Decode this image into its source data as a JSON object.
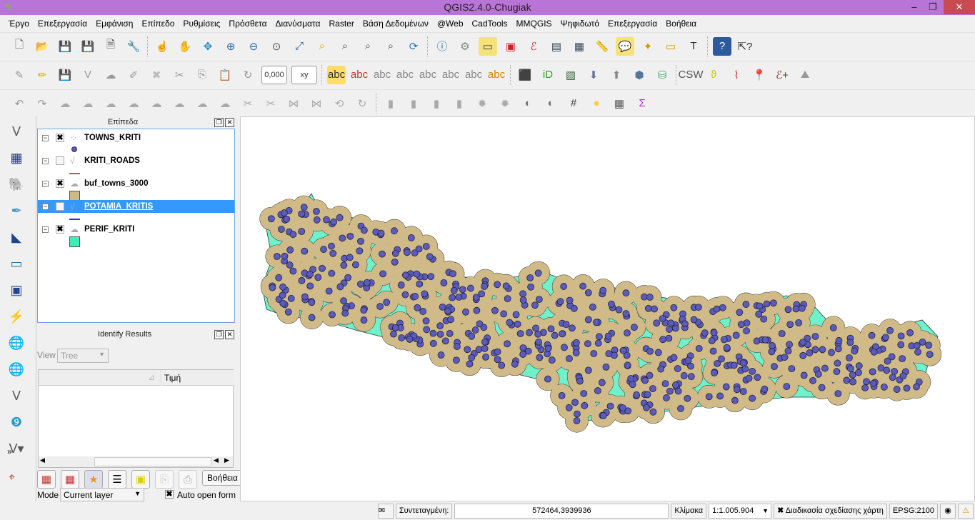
{
  "window": {
    "title": "QGIS2.4.0-Chugiak"
  },
  "menu": [
    "Έργο",
    "Επεξεργασία",
    "Εμφάνιση",
    "Επίπεδο",
    "Ρυθμίσεις",
    "Πρόσθετα",
    "Διανύσματα",
    "Raster",
    "Βάση Δεδομένων",
    "@Web",
    "CadTools",
    "MMQGIS",
    "Ψηφιδωτό",
    "Επεξεργασία",
    "Βοήθεια"
  ],
  "toolbar": {
    "offset_value": "0,000",
    "xy_label": "xy"
  },
  "layers_panel": {
    "title": "Επίπεδα",
    "layers": [
      {
        "name": "TOWNS_KRITI",
        "visible": true,
        "symbol": "point",
        "color": "#5a5ab8"
      },
      {
        "name": "KRITI_ROADS",
        "visible": false,
        "symbol": "line",
        "color": "#a0625a"
      },
      {
        "name": "buf_towns_3000",
        "visible": true,
        "symbol": "polygon",
        "color": "#cdb985"
      },
      {
        "name": "POTAMIA_KRITIS",
        "visible": false,
        "symbol": "line",
        "color": "#3232c8",
        "selected": true
      },
      {
        "name": "PERIF_KRITI",
        "visible": true,
        "symbol": "polygon",
        "color": "#3cf0b4"
      }
    ]
  },
  "identify_panel": {
    "title": "Identify Results",
    "view_label": "View",
    "view_value": "Tree",
    "column_value": "Τιμή",
    "help_button": "Βοήθεια",
    "mode_label": "Mode",
    "mode_value": "Current layer",
    "auto_open_label": "Auto open form",
    "auto_open_checked": true
  },
  "status": {
    "coord_label": "Συντεταγμένη:",
    "coord_value": "572464,3939936",
    "scale_label": "Κλίμακα",
    "scale_value": "1:1.005.904",
    "render_label": "Διαδικασία σχεδίασης χάρτη",
    "render_checked": true,
    "crs": "EPSG:2100"
  },
  "map": {
    "land_color": "#6ff2cc",
    "buffer_color": "#cfba88",
    "town_color": "#5b5bbf"
  }
}
